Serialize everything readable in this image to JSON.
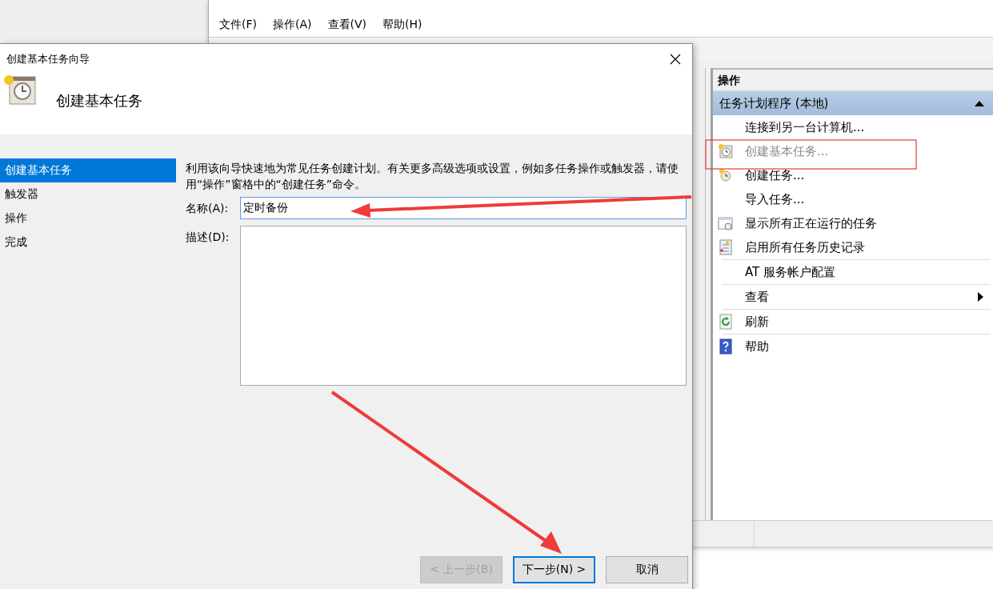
{
  "main_window": {
    "menu": [
      {
        "label": "文件(F)"
      },
      {
        "label": "操作(A)"
      },
      {
        "label": "查看(V)"
      },
      {
        "label": "帮助(H)"
      }
    ],
    "actions_pane": {
      "title": "操作",
      "group": {
        "label": "任务计划程序 (本地)",
        "expanded": true
      },
      "items": [
        {
          "label": "连接到另一台计算机...",
          "kind": "plain",
          "disabled": false,
          "divider_above": false
        },
        {
          "label": "创建基本任务...",
          "kind": "basic-task",
          "disabled": true,
          "divider_above": false
        },
        {
          "label": "创建任务...",
          "kind": "task",
          "disabled": false,
          "divider_above": false
        },
        {
          "label": "导入任务...",
          "kind": "plain",
          "disabled": false,
          "divider_above": false
        },
        {
          "label": "显示所有正在运行的任务",
          "kind": "running",
          "disabled": false,
          "divider_above": false
        },
        {
          "label": "启用所有任务历史记录",
          "kind": "history",
          "disabled": false,
          "divider_above": false
        },
        {
          "label": "AT 服务帐户配置",
          "kind": "plain",
          "disabled": false,
          "divider_above": true
        },
        {
          "label": "查看",
          "kind": "submenu",
          "disabled": false,
          "divider_above": true
        },
        {
          "label": "刷新",
          "kind": "refresh",
          "disabled": false,
          "divider_above": true
        },
        {
          "label": "帮助",
          "kind": "help",
          "disabled": false,
          "divider_above": true
        }
      ]
    }
  },
  "dialog": {
    "title": "创建基本任务向导",
    "heading": "创建基本任务",
    "steps": [
      {
        "label": "创建基本任务",
        "selected": true
      },
      {
        "label": "触发器",
        "selected": false
      },
      {
        "label": "操作",
        "selected": false
      },
      {
        "label": "完成",
        "selected": false
      }
    ],
    "intro": "利用该向导快速地为常见任务创建计划。有关更多高级选项或设置，例如多任务操作或触发器，请使用“操作”窗格中的“创建任务”命令。",
    "name_label": "名称(A):",
    "name_value": "定时备份",
    "description_label": "描述(D):",
    "buttons": [
      {
        "label": "< 上一步(B)",
        "kind": "back",
        "disabled": true
      },
      {
        "label": "下一步(N) >",
        "kind": "next",
        "disabled": false
      },
      {
        "label": "取消",
        "kind": "cancel",
        "disabled": false
      }
    ]
  }
}
